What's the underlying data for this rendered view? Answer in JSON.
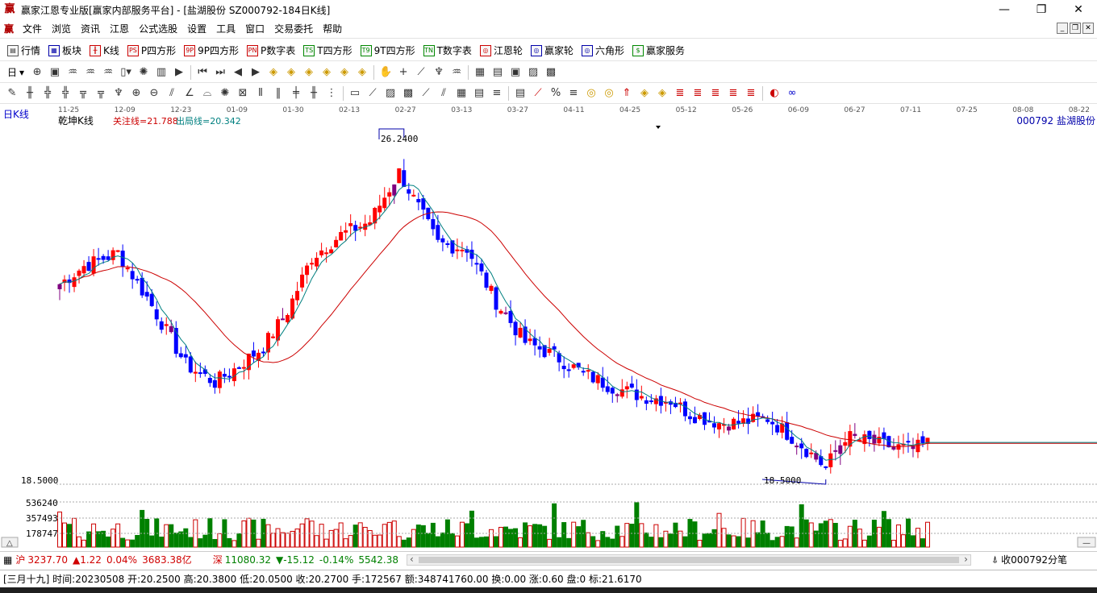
{
  "window": {
    "title": "赢家江恩专业版[赢家内部服务平台] - [盐湖股份  SZ000792-184日K线]",
    "logo": "赢",
    "controls": [
      "—",
      "❐",
      "✕"
    ]
  },
  "menu": {
    "logo": "赢",
    "items": [
      "文件",
      "浏览",
      "资讯",
      "江恩",
      "公式选股",
      "设置",
      "工具",
      "窗口",
      "交易委托",
      "帮助"
    ],
    "mdi_controls": [
      "_",
      "❐",
      "✕"
    ]
  },
  "toolbar1": {
    "items": [
      {
        "icon": "▤",
        "label": "行情"
      },
      {
        "icon": "▦",
        "label": "板块"
      },
      {
        "icon": "╫",
        "label": "K线"
      },
      {
        "icon": "PS",
        "label": "P四方形"
      },
      {
        "icon": "9P",
        "label": "9P四方形"
      },
      {
        "icon": "PN",
        "label": "P数字表"
      },
      {
        "icon": "TS",
        "label": "T四方形"
      },
      {
        "icon": "T9",
        "label": "9T四方形"
      },
      {
        "icon": "TN",
        "label": "T数字表"
      },
      {
        "icon": "◎",
        "label": "江恩轮"
      },
      {
        "icon": "◎",
        "label": "赢家轮"
      },
      {
        "icon": "◎",
        "label": "六角形"
      },
      {
        "icon": "$",
        "label": "赢家服务"
      }
    ]
  },
  "toolbar2": {
    "period_label": "日",
    "icons_count": 24
  },
  "toolbar3": {
    "icons_count": 48
  },
  "chart": {
    "period_tag": "日K线",
    "indicator_name": "乾坤K线",
    "focus_line_label": "关注线=21.788",
    "exit_line_label": "出局线=20.342",
    "stock_label": "000792  盐湖股份",
    "high_label": "26.2400",
    "low_label": "18.5000",
    "price_axis_label": "18.5000",
    "volume_ticks": [
      "536240",
      "357493",
      "178747"
    ],
    "date_labels": [
      "11-25",
      "12-09",
      "12-23",
      "01-09",
      "01-30",
      "02-13",
      "02-27",
      "03-13",
      "03-27",
      "04-11",
      "04-25",
      "05-12",
      "05-26",
      "06-09",
      "06-27",
      "07-11",
      "07-25",
      "08-08",
      "08-22"
    ],
    "colors": {
      "up": "#ff0000",
      "down": "#0000ff",
      "flat": "#800080",
      "ma_long": "#cc0000",
      "ma_short": "#008080",
      "vol": "#008000",
      "vol_up": "#cc0000"
    }
  },
  "chart_data": {
    "type": "candlestick",
    "title": "乾坤K线",
    "symbol": "000792 盐湖股份",
    "period": "日K线",
    "high": 26.24,
    "low": 18.5,
    "series": [
      {
        "name": "关注线",
        "last": 21.788
      },
      {
        "name": "出局线",
        "last": 20.342
      }
    ]
  },
  "status1": {
    "sh_icon": "沪",
    "sh_value": "3237.70",
    "sh_change": "▲1.22",
    "sh_pct": "0.04%",
    "sh_amount": "3683.38亿",
    "sz_icon": "深",
    "sz_value": "11080.32",
    "sz_change": "▼-15.12",
    "sz_pct": "-0.14%",
    "sz_amount": "5542.38",
    "right_label": "收000792分笔"
  },
  "status2": {
    "text": "[三月十九] 时间:20230508 开:20.2500 高:20.3800 低:20.0500 收:20.2700 手:172567 额:348741760.00 换:0.00 涨:0.60 盘:0 标:21.6170"
  }
}
